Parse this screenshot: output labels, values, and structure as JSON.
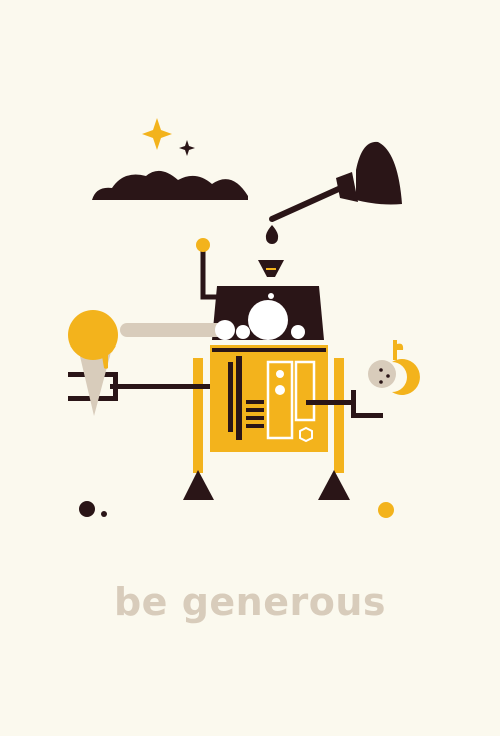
{
  "caption": "be generous",
  "colors": {
    "background": "#fbf9ee",
    "dark": "#2a1517",
    "gold": "#f3b31c",
    "beige": "#d8ccbb",
    "white": "#ffffff"
  },
  "icons": [
    "sparkle-icon",
    "cloud-icon",
    "plunger-icon",
    "ice-cream-cone-icon",
    "apple-icon",
    "robot-illustration"
  ]
}
